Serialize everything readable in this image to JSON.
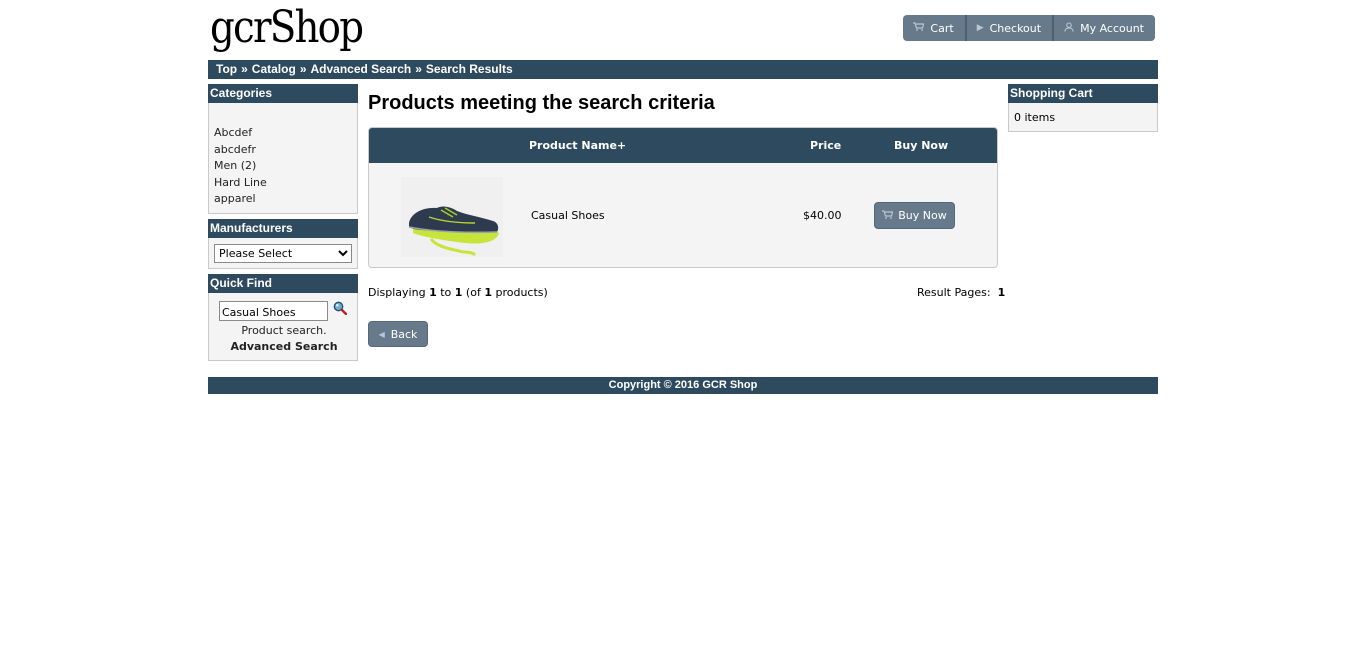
{
  "header": {
    "logo": "gcrShop",
    "buttons": {
      "cart": "Cart",
      "checkout": "Checkout",
      "account": "My Account"
    }
  },
  "breadcrumb": [
    "Top",
    "Catalog",
    "Advanced Search",
    "Search Results"
  ],
  "breadcrumb_sep": "»",
  "left": {
    "categories": {
      "heading": "Categories",
      "items": [
        "Abcdef",
        "abcdefr",
        "Men (2)",
        "Hard Line",
        "apparel"
      ]
    },
    "manufacturers": {
      "heading": "Manufacturers",
      "selected": "Please Select"
    },
    "quickfind": {
      "heading": "Quick Find",
      "value": "Casual Shoes",
      "note": "Product search.",
      "advanced": "Advanced Search"
    }
  },
  "main": {
    "title": "Products meeting the search criteria",
    "columns": {
      "name": "Product Name+",
      "price": "Price",
      "buy": "Buy Now"
    },
    "products": [
      {
        "name": "Casual Shoes",
        "price": "$40.00",
        "buy_label": "Buy Now"
      }
    ],
    "displaying": {
      "prefix": "Displaying",
      "from": "1",
      "to_word": "to",
      "to": "1",
      "of_prefix": "(of",
      "total": "1",
      "suffix": "products)"
    },
    "result_pages": {
      "label": "Result Pages:",
      "page": "1"
    },
    "back_label": "Back"
  },
  "right": {
    "cart": {
      "heading": "Shopping Cart",
      "items": "0 items"
    }
  },
  "footer": {
    "copyright": "Copyright © 2016 GCR Shop"
  },
  "colors": {
    "bar": "#2e4a5f",
    "button": "#667a8c",
    "panel": "#f4f4f4"
  }
}
